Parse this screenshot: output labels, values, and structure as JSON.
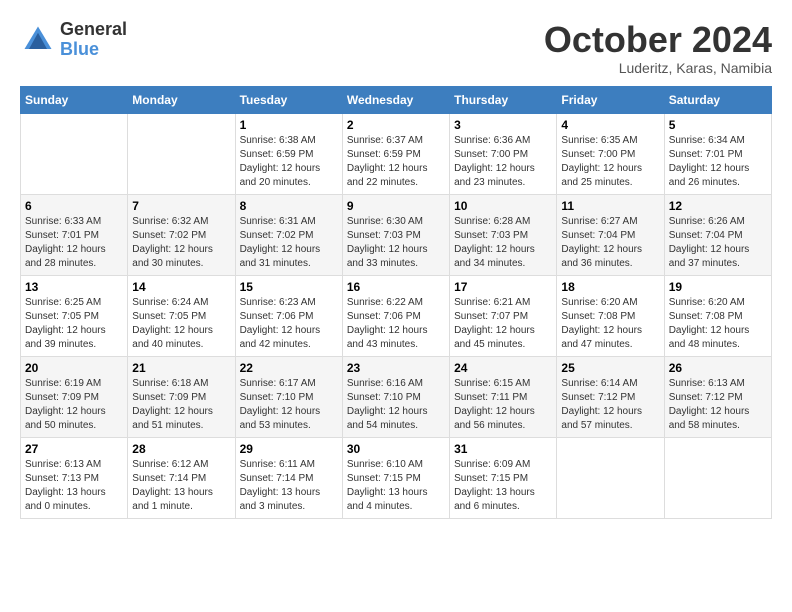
{
  "header": {
    "logo": {
      "line1": "General",
      "line2": "Blue"
    },
    "title": "October 2024",
    "location": "Luderitz, Karas, Namibia"
  },
  "days_of_week": [
    "Sunday",
    "Monday",
    "Tuesday",
    "Wednesday",
    "Thursday",
    "Friday",
    "Saturday"
  ],
  "weeks": [
    [
      {
        "day": "",
        "info": ""
      },
      {
        "day": "",
        "info": ""
      },
      {
        "day": "1",
        "info": "Sunrise: 6:38 AM\nSunset: 6:59 PM\nDaylight: 12 hours\nand 20 minutes."
      },
      {
        "day": "2",
        "info": "Sunrise: 6:37 AM\nSunset: 6:59 PM\nDaylight: 12 hours\nand 22 minutes."
      },
      {
        "day": "3",
        "info": "Sunrise: 6:36 AM\nSunset: 7:00 PM\nDaylight: 12 hours\nand 23 minutes."
      },
      {
        "day": "4",
        "info": "Sunrise: 6:35 AM\nSunset: 7:00 PM\nDaylight: 12 hours\nand 25 minutes."
      },
      {
        "day": "5",
        "info": "Sunrise: 6:34 AM\nSunset: 7:01 PM\nDaylight: 12 hours\nand 26 minutes."
      }
    ],
    [
      {
        "day": "6",
        "info": "Sunrise: 6:33 AM\nSunset: 7:01 PM\nDaylight: 12 hours\nand 28 minutes."
      },
      {
        "day": "7",
        "info": "Sunrise: 6:32 AM\nSunset: 7:02 PM\nDaylight: 12 hours\nand 30 minutes."
      },
      {
        "day": "8",
        "info": "Sunrise: 6:31 AM\nSunset: 7:02 PM\nDaylight: 12 hours\nand 31 minutes."
      },
      {
        "day": "9",
        "info": "Sunrise: 6:30 AM\nSunset: 7:03 PM\nDaylight: 12 hours\nand 33 minutes."
      },
      {
        "day": "10",
        "info": "Sunrise: 6:28 AM\nSunset: 7:03 PM\nDaylight: 12 hours\nand 34 minutes."
      },
      {
        "day": "11",
        "info": "Sunrise: 6:27 AM\nSunset: 7:04 PM\nDaylight: 12 hours\nand 36 minutes."
      },
      {
        "day": "12",
        "info": "Sunrise: 6:26 AM\nSunset: 7:04 PM\nDaylight: 12 hours\nand 37 minutes."
      }
    ],
    [
      {
        "day": "13",
        "info": "Sunrise: 6:25 AM\nSunset: 7:05 PM\nDaylight: 12 hours\nand 39 minutes."
      },
      {
        "day": "14",
        "info": "Sunrise: 6:24 AM\nSunset: 7:05 PM\nDaylight: 12 hours\nand 40 minutes."
      },
      {
        "day": "15",
        "info": "Sunrise: 6:23 AM\nSunset: 7:06 PM\nDaylight: 12 hours\nand 42 minutes."
      },
      {
        "day": "16",
        "info": "Sunrise: 6:22 AM\nSunset: 7:06 PM\nDaylight: 12 hours\nand 43 minutes."
      },
      {
        "day": "17",
        "info": "Sunrise: 6:21 AM\nSunset: 7:07 PM\nDaylight: 12 hours\nand 45 minutes."
      },
      {
        "day": "18",
        "info": "Sunrise: 6:20 AM\nSunset: 7:08 PM\nDaylight: 12 hours\nand 47 minutes."
      },
      {
        "day": "19",
        "info": "Sunrise: 6:20 AM\nSunset: 7:08 PM\nDaylight: 12 hours\nand 48 minutes."
      }
    ],
    [
      {
        "day": "20",
        "info": "Sunrise: 6:19 AM\nSunset: 7:09 PM\nDaylight: 12 hours\nand 50 minutes."
      },
      {
        "day": "21",
        "info": "Sunrise: 6:18 AM\nSunset: 7:09 PM\nDaylight: 12 hours\nand 51 minutes."
      },
      {
        "day": "22",
        "info": "Sunrise: 6:17 AM\nSunset: 7:10 PM\nDaylight: 12 hours\nand 53 minutes."
      },
      {
        "day": "23",
        "info": "Sunrise: 6:16 AM\nSunset: 7:10 PM\nDaylight: 12 hours\nand 54 minutes."
      },
      {
        "day": "24",
        "info": "Sunrise: 6:15 AM\nSunset: 7:11 PM\nDaylight: 12 hours\nand 56 minutes."
      },
      {
        "day": "25",
        "info": "Sunrise: 6:14 AM\nSunset: 7:12 PM\nDaylight: 12 hours\nand 57 minutes."
      },
      {
        "day": "26",
        "info": "Sunrise: 6:13 AM\nSunset: 7:12 PM\nDaylight: 12 hours\nand 58 minutes."
      }
    ],
    [
      {
        "day": "27",
        "info": "Sunrise: 6:13 AM\nSunset: 7:13 PM\nDaylight: 13 hours\nand 0 minutes."
      },
      {
        "day": "28",
        "info": "Sunrise: 6:12 AM\nSunset: 7:14 PM\nDaylight: 13 hours\nand 1 minute."
      },
      {
        "day": "29",
        "info": "Sunrise: 6:11 AM\nSunset: 7:14 PM\nDaylight: 13 hours\nand 3 minutes."
      },
      {
        "day": "30",
        "info": "Sunrise: 6:10 AM\nSunset: 7:15 PM\nDaylight: 13 hours\nand 4 minutes."
      },
      {
        "day": "31",
        "info": "Sunrise: 6:09 AM\nSunset: 7:15 PM\nDaylight: 13 hours\nand 6 minutes."
      },
      {
        "day": "",
        "info": ""
      },
      {
        "day": "",
        "info": ""
      }
    ]
  ]
}
